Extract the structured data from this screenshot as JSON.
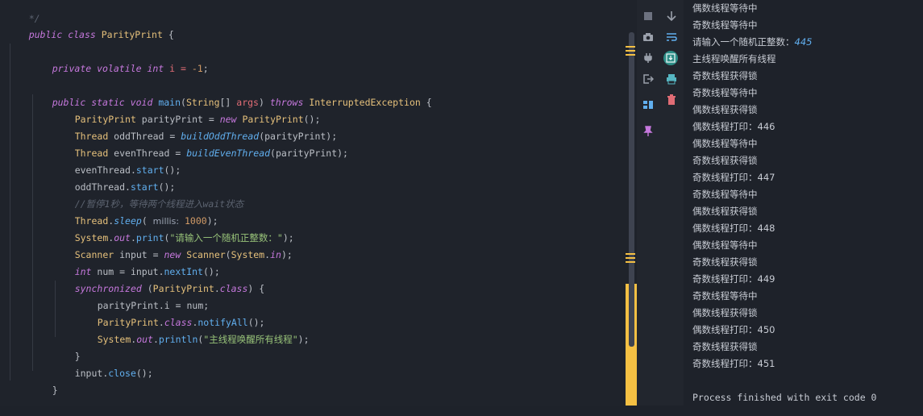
{
  "editor": {
    "top_fragment": "*/",
    "class_decl": {
      "kw1": "public",
      "kw2": "class",
      "name": "ParityPrint",
      "brace": " {"
    },
    "field": {
      "kw1": "private",
      "kw2": "volatile",
      "kw3": "int",
      "name": " i = ",
      "value": "-1",
      "end": ";"
    },
    "main_decl": {
      "kw1": "public",
      "kw2": "static",
      "kw3": "void",
      "name": "main",
      "open": "(",
      "type": "String",
      "arr": "[] ",
      "param": "args",
      "close": ") ",
      "throws": "throws",
      "exc": "InterruptedException",
      "brace": " {"
    },
    "l1": {
      "t": "ParityPrint",
      "v": " parityPrint = ",
      "kw": "new",
      "ctor": "ParityPrint",
      "end": "();"
    },
    "l2": {
      "t": "Thread",
      "v": " oddThread = ",
      "fn": "buildOddThread",
      "arg": "(parityPrint);"
    },
    "l3": {
      "t": "Thread",
      "v": " evenThread = ",
      "fn": "buildEvenThread",
      "arg": "(parityPrint);"
    },
    "l4": {
      "obj": "evenThread.",
      "fn": "start",
      "end": "();"
    },
    "l5": {
      "obj": "oddThread.",
      "fn": "start",
      "end": "();"
    },
    "l6": {
      "comment": "//暂停1秒，等待两个线程进入wait状态"
    },
    "l7": {
      "t": "Thread",
      "dot": ".",
      "fn": "sleep",
      "open": "( ",
      "hint": "millis:",
      "val": " 1000",
      "end": ");"
    },
    "l8": {
      "t": "System",
      "dot": ".",
      "fld": "out",
      "dot2": ".",
      "fn": "print",
      "open": "(",
      "str": "\"请输入一个随机正整数：\"",
      "end": ");"
    },
    "l9": {
      "t": "Scanner",
      "v": " input = ",
      "kw": "new",
      "ctor": "Scanner",
      "open": "(",
      "t2": "System",
      "dot": ".",
      "fld": "in",
      "end": ");"
    },
    "l10": {
      "kw": "int",
      "v": " num = input.",
      "fn": "nextInt",
      "end": "();"
    },
    "l11": {
      "kw": "synchronized",
      "open": " (",
      "t": "ParityPrint",
      "dot": ".",
      "kw2": "class",
      "end": ") {"
    },
    "l12": {
      "text": "parityPrint.i = num;"
    },
    "l13": {
      "t": "ParityPrint",
      "dot": ".",
      "kw": "class",
      "dot2": ".",
      "fn": "notifyAll",
      "end": "();"
    },
    "l14": {
      "t": "System",
      "dot": ".",
      "fld": "out",
      "dot2": ".",
      "fn": "println",
      "open": "(",
      "str": "\"主线程唤醒所有线程\"",
      "end": ");"
    },
    "l15": {
      "text": "}"
    },
    "l16": {
      "obj": "input.",
      "fn": "close",
      "end": "();"
    },
    "l17": {
      "text": "}"
    }
  },
  "toolbar": {
    "icons": [
      "stop-icon",
      "scroll-down-icon",
      "camera-icon",
      "soft-wrap-icon",
      "plug-icon",
      "scroll-to-end-icon",
      "exit-icon",
      "print-icon",
      "layout-icon",
      "trash-icon",
      "pin-icon"
    ]
  },
  "console": {
    "lines": [
      {
        "text": "偶数线程等待中"
      },
      {
        "text": "奇数线程等待中"
      },
      {
        "text": "请输入一个随机正整数：",
        "input": "445"
      },
      {
        "text": "主线程唤醒所有线程"
      },
      {
        "text": "奇数线程获得锁"
      },
      {
        "text": "奇数线程等待中"
      },
      {
        "text": "偶数线程获得锁"
      },
      {
        "text": "偶数线程打印：446"
      },
      {
        "text": "偶数线程等待中"
      },
      {
        "text": "奇数线程获得锁"
      },
      {
        "text": "奇数线程打印：447"
      },
      {
        "text": "奇数线程等待中"
      },
      {
        "text": "偶数线程获得锁"
      },
      {
        "text": "偶数线程打印：448"
      },
      {
        "text": "偶数线程等待中"
      },
      {
        "text": "奇数线程获得锁"
      },
      {
        "text": "奇数线程打印：449"
      },
      {
        "text": "奇数线程等待中"
      },
      {
        "text": "偶数线程获得锁"
      },
      {
        "text": "偶数线程打印：450"
      },
      {
        "text": "奇数线程获得锁"
      },
      {
        "text": "奇数线程打印：451"
      }
    ],
    "exit_message": "Process finished with exit code 0"
  },
  "colors": {
    "editor_bg": "#1f232b",
    "keyword": "#c678dd",
    "type": "#e5c07b",
    "function": "#61afef",
    "number": "#d19a66",
    "string": "#98c379",
    "comment": "#5c6370",
    "marker": "#f5c043"
  }
}
